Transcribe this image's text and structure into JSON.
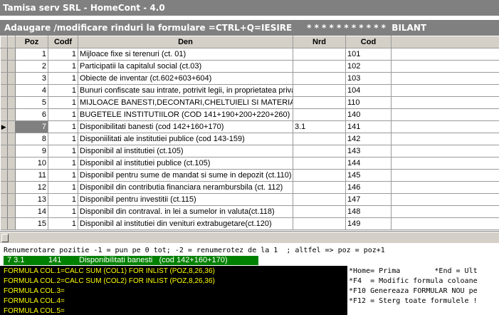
{
  "window": {
    "title": "Tamisa serv SRL - HomeCont - 4.0"
  },
  "header": {
    "text": "Adaugare /modificare rinduri la formulare =CTRL+Q=IESIRE     * * * * * * * * * * *  BILANT"
  },
  "columns": {
    "poz": "Poz",
    "codf": "Codf",
    "den": "Den",
    "nrd": "Nrd",
    "cod": "Cod"
  },
  "rows": [
    {
      "poz": "1",
      "codf": "1",
      "den": "Mijloace fixe si terenuri (ct. 01)",
      "nrd": "",
      "cod": "101"
    },
    {
      "poz": "2",
      "codf": "1",
      "den": "Participatii la capitalul social (ct.03)",
      "nrd": "",
      "cod": "102"
    },
    {
      "poz": "3",
      "codf": "1",
      "den": "Obiecte de inventar       (ct.602+603+604)",
      "nrd": "",
      "cod": "103"
    },
    {
      "poz": "4",
      "codf": "1",
      "den": "Bunuri confiscate sau intrate, potrivit legii, in proprietatea priva",
      "nrd": "",
      "cod": "104"
    },
    {
      "poz": "5",
      "codf": "1",
      "den": "MIJLOACE BANESTI,DECONTARI,CHELTUIELI SI MATERIALE (cB.",
      "nrd": "",
      "cod": "110"
    },
    {
      "poz": "6",
      "codf": "1",
      "den": "BUGETELE INSTITUTIILOR (COD 141+190+200+220+260)",
      "nrd": "",
      "cod": "140"
    },
    {
      "poz": "7",
      "codf": "1",
      "den": "Disponibilitati banesti   (cod 142+160+170)",
      "nrd": "3.1",
      "cod": "141",
      "current": true
    },
    {
      "poz": "8",
      "codf": "1",
      "den": "Disponiilitati ale institutiei publice (cod 143-159)",
      "nrd": "",
      "cod": "142"
    },
    {
      "poz": "9",
      "codf": "1",
      "den": "Disponibil al institutiei (ct.105)",
      "nrd": "",
      "cod": "143"
    },
    {
      "poz": "10",
      "codf": "1",
      "den": "Disponibil al institutiei publice (ct.105)",
      "nrd": "",
      "cod": "144"
    },
    {
      "poz": "11",
      "codf": "1",
      "den": "Disponibil pentru sume de mandat si sume in depozit (ct.110)",
      "nrd": "",
      "cod": "145"
    },
    {
      "poz": "12",
      "codf": "1",
      "den": "Disponibil din contributia financiara nerambursbila (ct. 112)",
      "nrd": "",
      "cod": "146"
    },
    {
      "poz": "13",
      "codf": "1",
      "den": "Disponibil pentru investitii (ct.115)",
      "nrd": "",
      "cod": "147"
    },
    {
      "poz": "14",
      "codf": "1",
      "den": "Disponibil din contraval. in lei a sumelor in valuta(ct.118)",
      "nrd": "",
      "cod": "148"
    },
    {
      "poz": "15",
      "codf": "1",
      "den": "Disponibil al institutiei din venituri extrabugetare(ct.120)",
      "nrd": "",
      "cod": "149"
    }
  ],
  "current_marker": "▶",
  "console": {
    "renumber": "Renumerotare pozitie -1 = pun pe 0 tot; -2 = renumerotez de la 1  ; altfel => poz = poz+1",
    "current_a": "7 3.1",
    "current_b": "141",
    "current_c": "Disponibilitati banesti   (cod 142+160+170)",
    "formulas": [
      "FORMULA COL.1=CALC SUM (COL1) FOR INLIST (POZ,8,26,36)",
      "FORMULA COL.2=CALC SUM (COL2) FOR INLIST (POZ,8,26,36)",
      "FORMULA COL.3=",
      "FORMULA COL.4=",
      "FORMULA COL.5="
    ],
    "help": [
      "*Home= Prima        *End = Ult",
      "*F4  = Modific formula coloane",
      "*F10 Genereaza FORMULAR NOU pe",
      "*F12 = Sterg toate formulele !"
    ]
  },
  "colors": {
    "title_bg": "#808080",
    "green": "#008000",
    "formula_text": "#ffff00"
  }
}
